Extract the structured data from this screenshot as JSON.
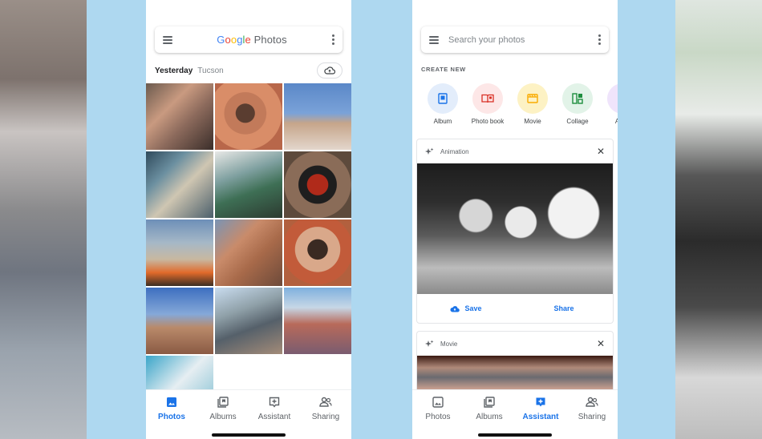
{
  "left_phone": {
    "header": {
      "logo_google": "Google",
      "logo_photos": "Photos"
    },
    "date_row": {
      "day": "Yesterday",
      "place": "Tucson"
    },
    "photo_count": 13,
    "nav": [
      {
        "label": "Photos",
        "icon": "photos-icon",
        "active": true
      },
      {
        "label": "Albums",
        "icon": "albums-icon",
        "active": false
      },
      {
        "label": "Assistant",
        "icon": "assistant-icon",
        "active": false
      },
      {
        "label": "Sharing",
        "icon": "sharing-icon",
        "active": false
      }
    ]
  },
  "right_phone": {
    "search": {
      "placeholder": "Search your photos"
    },
    "create_new": {
      "heading": "CREATE NEW",
      "items": [
        {
          "label": "Album",
          "icon": "album-icon",
          "color": "#e3edfb",
          "fg": "#1a73e8"
        },
        {
          "label": "Photo book",
          "icon": "photo-book-icon",
          "color": "#fde7e7",
          "fg": "#d93025"
        },
        {
          "label": "Movie",
          "icon": "movie-icon",
          "color": "#fdf2c4",
          "fg": "#f9ab00"
        },
        {
          "label": "Collage",
          "icon": "collage-icon",
          "color": "#e2f3e8",
          "fg": "#1e8e3e"
        },
        {
          "label": "Anim",
          "icon": "animation-icon",
          "color": "#efe4fb",
          "fg": "#9334e6"
        }
      ]
    },
    "animation_card": {
      "title": "Animation",
      "save": "Save",
      "share": "Share"
    },
    "movie_card": {
      "title": "Movie"
    },
    "nav": [
      {
        "label": "Photos",
        "icon": "photos-icon",
        "active": false
      },
      {
        "label": "Albums",
        "icon": "albums-icon",
        "active": false
      },
      {
        "label": "Assistant",
        "icon": "assistant-icon",
        "active": true
      },
      {
        "label": "Sharing",
        "icon": "sharing-icon",
        "active": false
      }
    ]
  },
  "colors": {
    "accent": "#1a73e8",
    "background": "#aed8f0"
  }
}
